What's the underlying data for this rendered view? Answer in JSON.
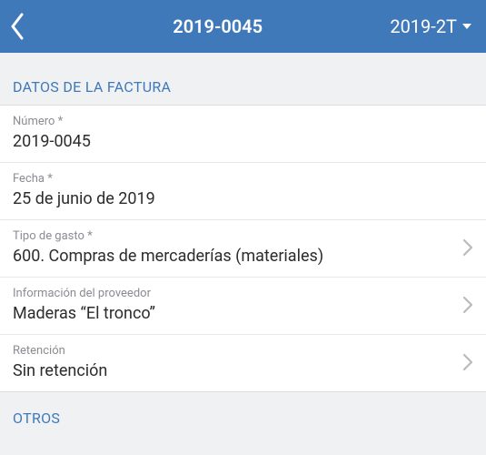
{
  "navbar": {
    "title": "2019-0045",
    "period": "2019-2T"
  },
  "sections": {
    "invoice_header": "Datos de la factura",
    "others_header": "Otros"
  },
  "invoice": {
    "number": {
      "label": "Número *",
      "value": "2019-0045"
    },
    "date": {
      "label": "Fecha *",
      "value": "25 de junio de 2019"
    },
    "expense_type": {
      "label": "Tipo de gasto *",
      "value": "600. Compras de mercaderías (materiales)"
    },
    "supplier": {
      "label": "Información del proveedor",
      "value": "Maderas “El tronco”"
    },
    "retention": {
      "label": "Retención",
      "value": "Sin retención"
    }
  }
}
